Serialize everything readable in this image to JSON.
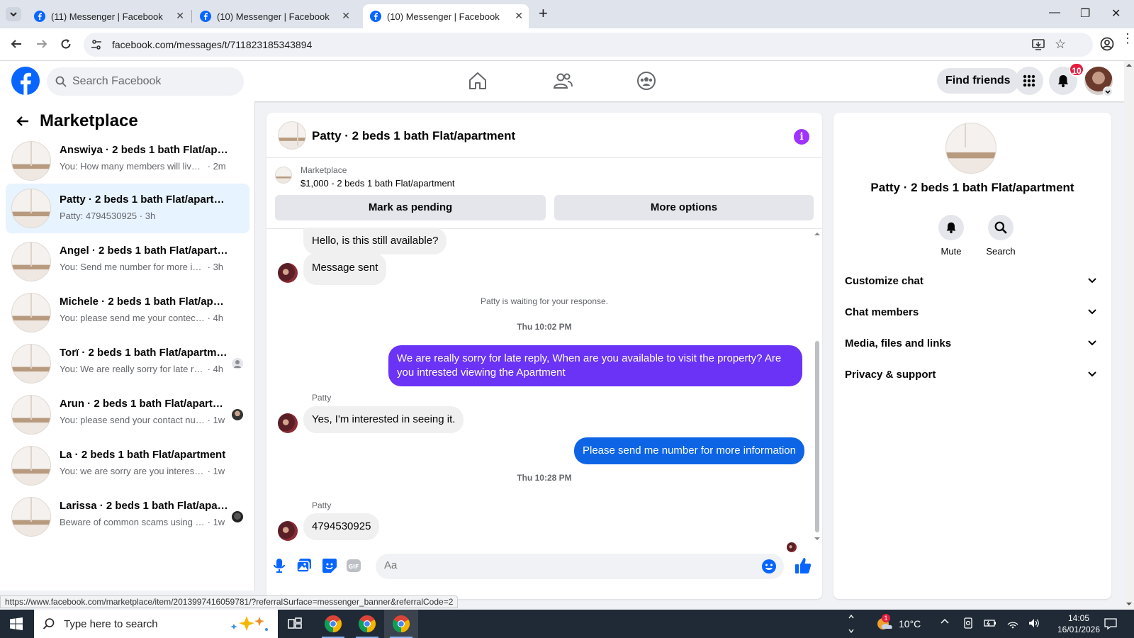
{
  "browser": {
    "tabs": [
      {
        "title": "(11) Messenger | Facebook",
        "active": false
      },
      {
        "title": "(10) Messenger | Facebook",
        "active": false
      },
      {
        "title": "(10) Messenger | Facebook",
        "active": true
      }
    ],
    "url": "facebook.com/messages/t/711823185343894",
    "status_url": "https://www.facebook.com/marketplace/item/2013997416059781/?referralSurface=messenger_banner&referralCode=2"
  },
  "fb_header": {
    "search_placeholder": "Search Facebook",
    "find_friends_label": "Find friends",
    "notification_count": "10"
  },
  "sidebar": {
    "title": "Marketplace",
    "conversations": [
      {
        "name": "Answiya · 2 beds 1 bath Flat/apart...",
        "preview": "You: How many members will live in t...",
        "time": "· 2m"
      },
      {
        "name": "Patty · 2 beds 1 bath Flat/apartment",
        "preview": "Patty: 4794530925",
        "time": "· 3h",
        "selected": true
      },
      {
        "name": "Angel · 2 beds 1 bath Flat/apartme...",
        "preview": "You: Send me number for more infor...",
        "time": "· 3h"
      },
      {
        "name": "Michele · 2 beds 1 bath Flat/apart...",
        "preview": "You: please send me your contect nu...",
        "time": "· 4h"
      },
      {
        "name": "Torï · 2 beds 1 bath Flat/apartme...",
        "preview": "You: We are really sorry for late rep...",
        "time": "· 4h"
      },
      {
        "name": "Arun · 2 beds 1 bath Flat/apartm...",
        "preview": "You: please send your contact num...",
        "time": "· 1w"
      },
      {
        "name": "La · 2 beds 1 bath Flat/apartment",
        "preview": "You: we are sorry are you interested n...",
        "time": "· 1w"
      },
      {
        "name": "Larissa · 2 beds 1 bath Flat/apart...",
        "preview": "Beware of common scams using p...",
        "time": "· 1w"
      }
    ]
  },
  "chat": {
    "title": "Patty · 2 beds 1 bath Flat/apartment",
    "marketplace_label": "Marketplace",
    "listing": "$1,000 - 2 beds 1 bath Flat/apartment",
    "mark_pending_label": "Mark as pending",
    "more_options_label": "More options",
    "messages": {
      "m1": "Hello, is this still available?",
      "m2": "Message sent",
      "waiting": "Patty is waiting for your response.",
      "ts1": "Thu 10:02 PM",
      "m3": "We are really sorry for late reply, When are you available to visit the property? Are you intrested viewing the Apartment",
      "sender1": "Patty",
      "m4": "Yes, I'm interested in seeing it.",
      "m5": "Please send me number for more information",
      "ts2": "Thu 10:28 PM",
      "sender2": "Patty",
      "m6": "4794530925"
    },
    "composer_placeholder": "Aa"
  },
  "details": {
    "title": "Patty · 2 beds 1 bath Flat/apartment",
    "mute_label": "Mute",
    "search_label": "Search",
    "sections": [
      "Customize chat",
      "Chat members",
      "Media, files and links",
      "Privacy & support"
    ]
  },
  "taskbar": {
    "search_placeholder": "Type here to search",
    "temperature": "10°C",
    "time": "14:05",
    "date": "16/01/2026",
    "weather_badge": "1"
  },
  "colors": {
    "fb_blue": "#0866ff",
    "outgoing_purple": "#6b33f5",
    "outgoing_blue": "#0d65e6",
    "selected_bg": "#e7f3ff",
    "notification_red": "#e41e3f",
    "info_purple": "#a033ff"
  }
}
